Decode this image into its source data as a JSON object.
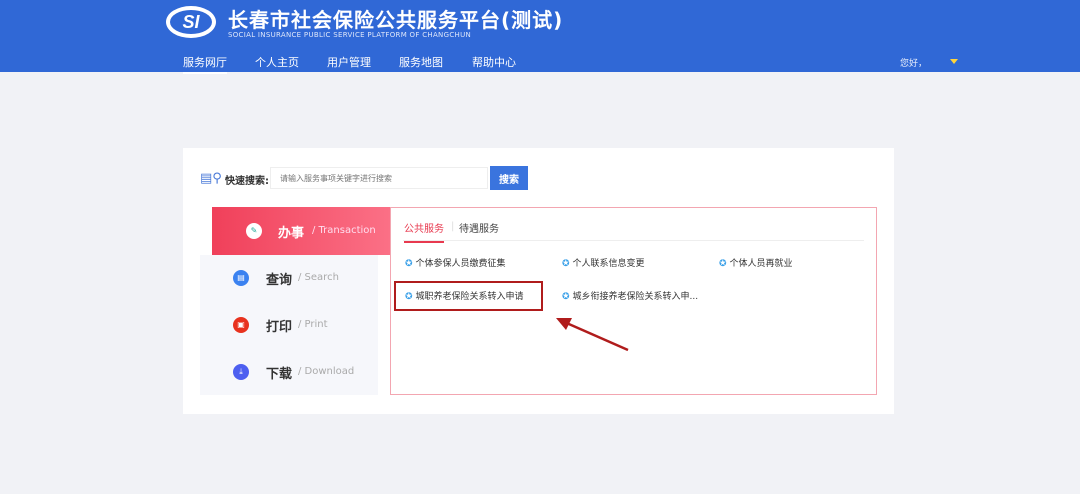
{
  "header": {
    "logo": "SI",
    "title": "长春市社会保险公共服务平台(测试)",
    "subtitle": "SOCIAL INSURANCE PUBLIC SERVICE PLATFORM OF CHANGCHUN",
    "nav": [
      "服务网厅",
      "个人主页",
      "用户管理",
      "服务地图",
      "帮助中心"
    ],
    "greeting": "您好，"
  },
  "search": {
    "label": "快速搜索:",
    "placeholder": "请输入服务事项关键字进行搜索",
    "button": "搜索"
  },
  "menu": [
    {
      "cn": "办事",
      "en": "/ Transaction"
    },
    {
      "cn": "查询",
      "en": "/ Search"
    },
    {
      "cn": "打印",
      "en": "/ Print"
    },
    {
      "cn": "下载",
      "en": "/ Download"
    }
  ],
  "tabs": [
    "公共服务",
    "待遇服务"
  ],
  "services": [
    "个体参保人员缴费征集",
    "个人联系信息变更",
    "个体人员再就业",
    "城职养老保险关系转入申请",
    "城乡衔接养老保险关系转入申..."
  ]
}
